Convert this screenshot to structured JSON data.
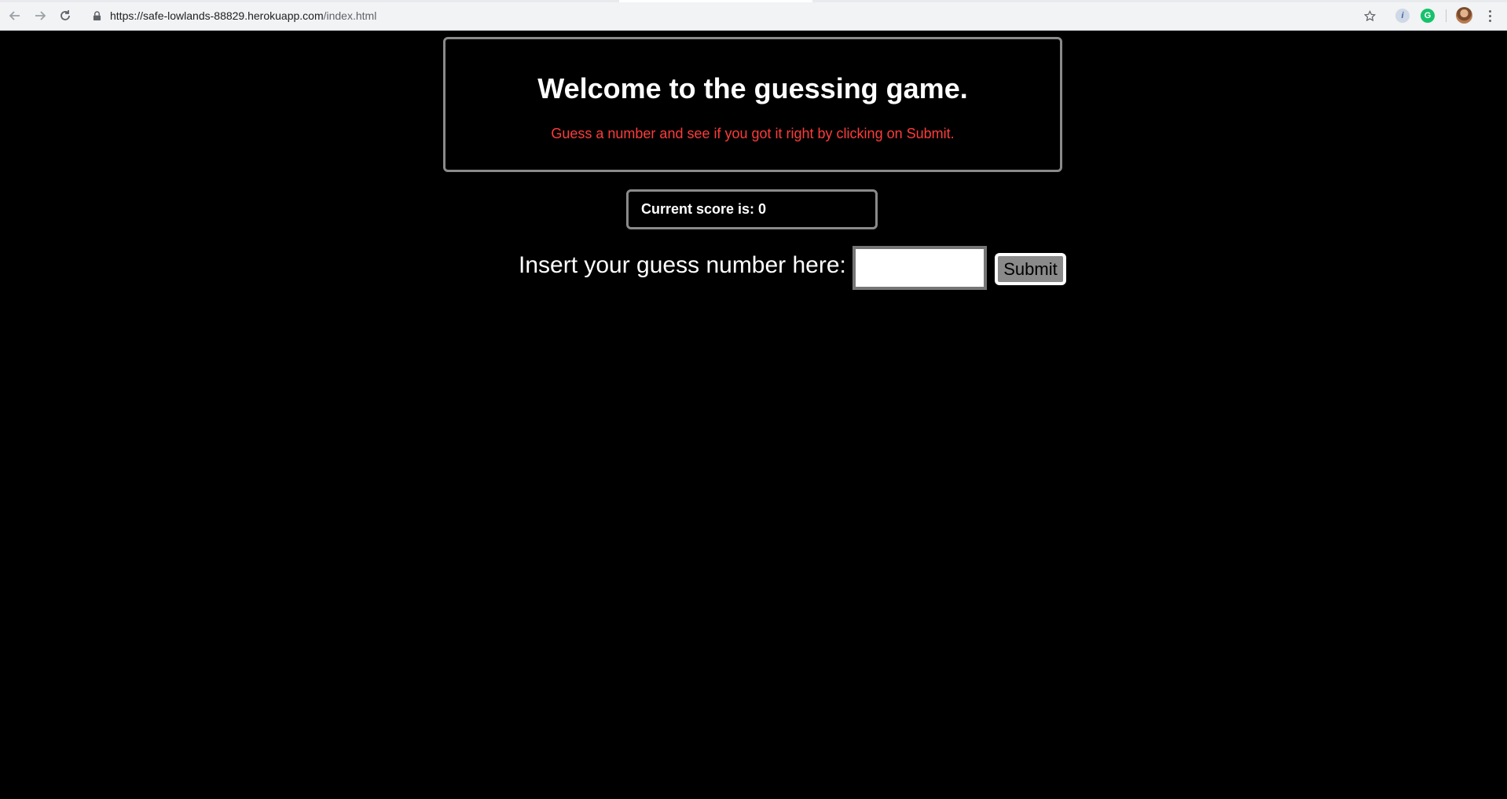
{
  "browser": {
    "url_host": "https://safe-lowlands-88829.herokuapp.com",
    "url_path": "/index.html",
    "icons": [
      "back-arrow-icon",
      "forward-arrow-icon",
      "reload-icon",
      "lock-icon",
      "star-icon",
      "extension-icon",
      "grammarly-icon",
      "profile-avatar",
      "menu-kebab-icon"
    ],
    "extension_glyphs": {
      "first": "i",
      "second": "G"
    }
  },
  "welcome": {
    "title": "Welcome to the guessing game.",
    "subtitle": "Guess a number and see if you got it right by clicking on Submit.",
    "subtitle_color": "#ff3b3b"
  },
  "score": {
    "text": "Current score is: 0"
  },
  "guess": {
    "label": "Insert your guess number here:",
    "input_value": "",
    "submit_label": "Submit"
  }
}
